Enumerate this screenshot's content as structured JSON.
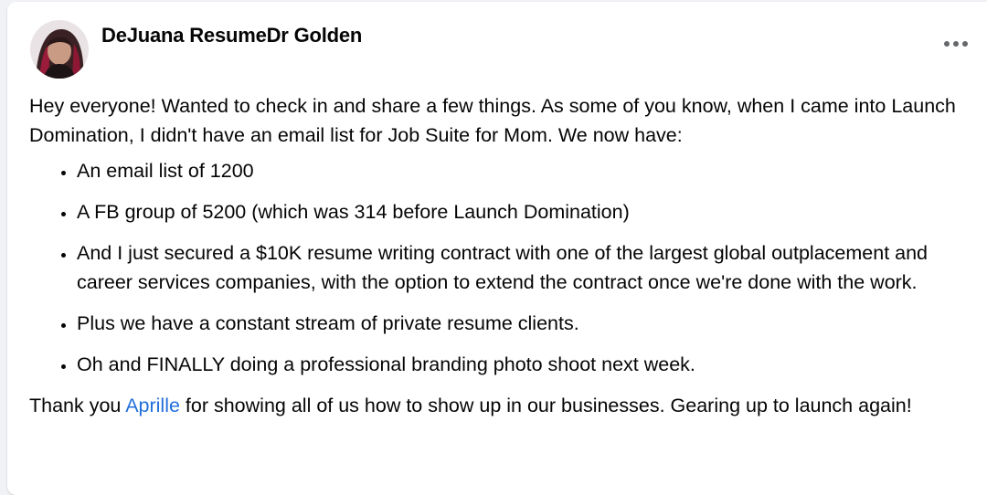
{
  "post": {
    "author": "DeJuana ResumeDr Golden",
    "more_icon": "more-horizontal-icon",
    "intro": "Hey everyone! Wanted to check in and share a few things. As some of you know, when I came into Launch Domination, I didn't have an email list for Job Suite for Mom. We now have:",
    "bullets": [
      "An email list of 1200",
      "A FB group of 5200 (which was 314 before Launch Domination)",
      "And I just secured a $10K resume writing contract with one of the largest global outplacement and career services companies, with the option to extend the contract once we're done with the work.",
      "Plus we have a constant stream of private resume clients.",
      "Oh and FINALLY doing a professional branding photo shoot next week."
    ],
    "outro_before": "Thank you ",
    "mention": "Aprille",
    "outro_after": " for showing all of us how to show up in our businesses. Gearing up to launch again!"
  },
  "colors": {
    "text": "#050505",
    "mention": "#216fdb",
    "background": "#ffffff"
  }
}
